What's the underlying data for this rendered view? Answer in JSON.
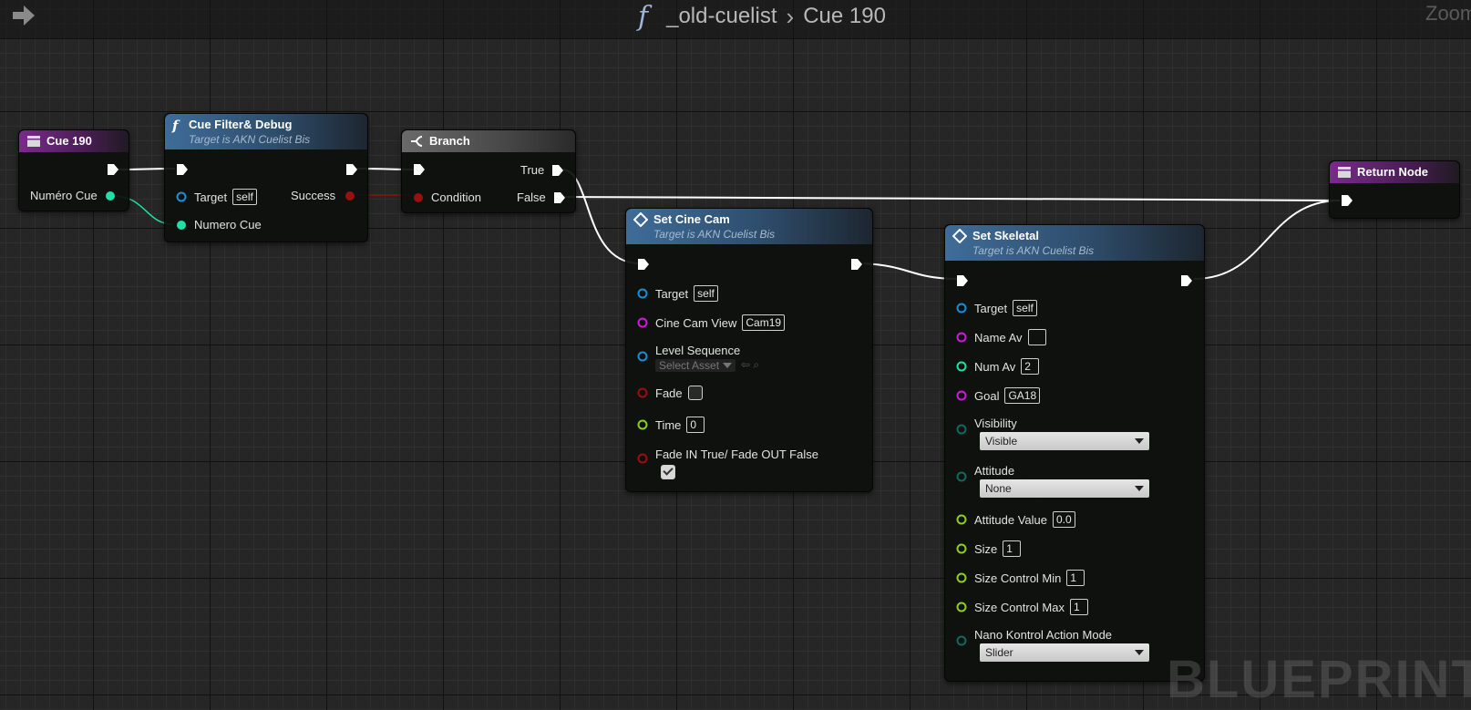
{
  "breadcrumb": {
    "function_icon": "f",
    "parent": "_old-cuelist",
    "separator": "›",
    "current": "Cue 190"
  },
  "zoom_label": "Zoom",
  "watermark": "BLUEPRINT",
  "icons": {
    "back": "back-arrow-icon",
    "event": "event-node-icon",
    "function": "function-icon",
    "branch": "branch-icon",
    "macro": "diamond-icon",
    "exec_pin": "exec-pin-icon",
    "data_pin": "data-pin-icon"
  },
  "pin_colors": {
    "exec": "#ffffff",
    "int": "#1fe0a7",
    "bool": "#9a0f0f",
    "object": "#1b8fd6",
    "name": "#d11ad8",
    "float": "#8bd11a",
    "enum": "#0b6b5d"
  },
  "nodes": {
    "cue190": {
      "title": "Cue 190",
      "output_pin": "Numéro Cue"
    },
    "cue_filter": {
      "title": "Cue Filter& Debug",
      "subtitle": "Target is AKN Cuelist Bis",
      "target_label": "Target",
      "target_value": "self",
      "numero_label": "Numero Cue",
      "success_label": "Success"
    },
    "branch": {
      "title": "Branch",
      "condition_label": "Condition",
      "true_label": "True",
      "false_label": "False"
    },
    "set_cine_cam": {
      "title": "Set Cine Cam",
      "subtitle": "Target is AKN Cuelist Bis",
      "target_label": "Target",
      "target_value": "self",
      "cine_cam_label": "Cine Cam View",
      "cine_cam_value": "Cam19",
      "level_seq_label": "Level Sequence",
      "level_seq_value": "Select Asset",
      "fade_label": "Fade",
      "fade_checked": false,
      "time_label": "Time",
      "time_value": "0",
      "fade_in_label": "Fade IN True/ Fade OUT False",
      "fade_in_checked": true
    },
    "set_skeletal": {
      "title": "Set Skeletal",
      "subtitle": "Target is AKN Cuelist Bis",
      "target_label": "Target",
      "target_value": "self",
      "name_av_label": "Name Av",
      "name_av_value": "",
      "num_av_label": "Num Av",
      "num_av_value": "2",
      "goal_label": "Goal",
      "goal_value": "GA18",
      "visibility_label": "Visibility",
      "visibility_value": "Visible",
      "attitude_label": "Attitude",
      "attitude_value": "None",
      "attitude_val_label": "Attitude Value",
      "attitude_val_value": "0.0",
      "size_label": "Size",
      "size_value": "1",
      "size_min_label": "Size Control Min",
      "size_min_value": "1",
      "size_max_label": "Size Control Max",
      "size_max_value": "1",
      "nano_label": "Nano Kontrol Action Mode",
      "nano_value": "Slider"
    },
    "return_node": {
      "title": "Return Node"
    }
  }
}
